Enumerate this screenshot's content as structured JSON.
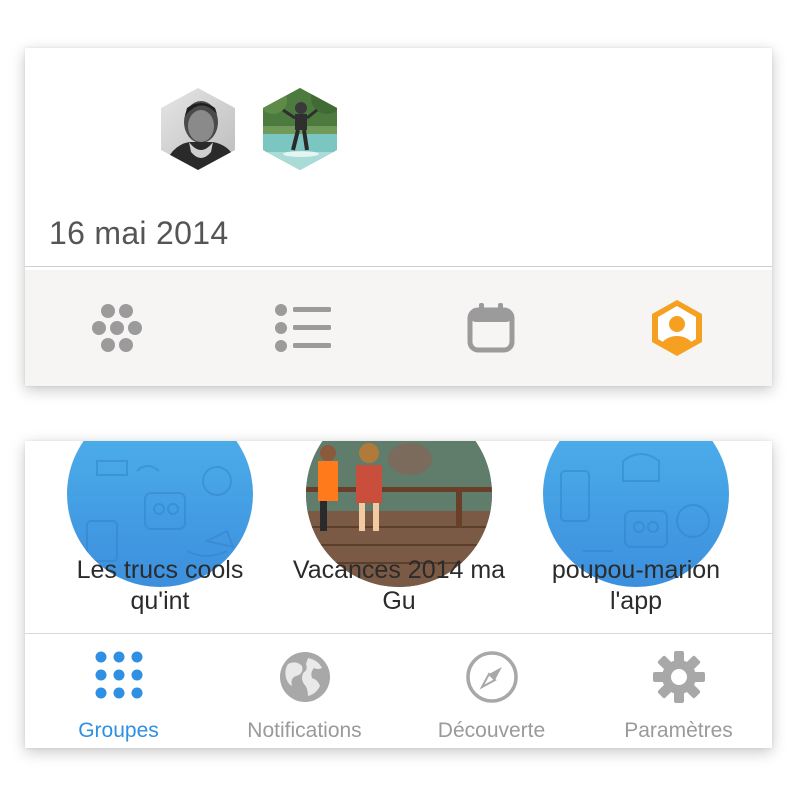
{
  "event_card": {
    "date": "16 mai 2014"
  },
  "toolbar": {
    "icons": [
      "groups-icon",
      "list-icon",
      "calendar-icon",
      "profile-icon"
    ],
    "active_color": "#f6a021",
    "inactive_color": "#9b9b9b"
  },
  "groups": [
    {
      "label": "Les trucs cools qu'int"
    },
    {
      "label": "Vacances 2014 ma Gu"
    },
    {
      "label": "poupou-marion l'app"
    }
  ],
  "tabbar": {
    "active_color": "#2f8fe3",
    "inactive_color": "#9a9a9a",
    "tabs": [
      {
        "label": "Groupes",
        "icon": "dots-grid-icon",
        "active": true
      },
      {
        "label": "Notifications",
        "icon": "globe-icon",
        "active": false
      },
      {
        "label": "Découverte",
        "icon": "compass-icon",
        "active": false
      },
      {
        "label": "Paramètres",
        "icon": "gear-icon",
        "active": false
      }
    ]
  }
}
